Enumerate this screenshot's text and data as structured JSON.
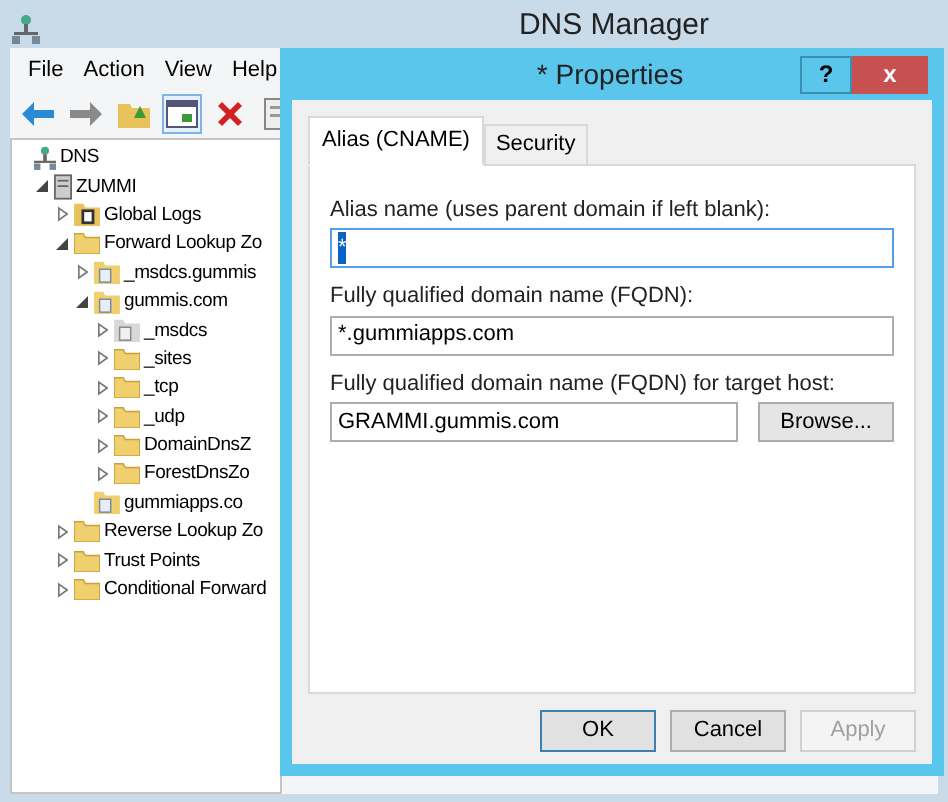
{
  "window": {
    "title": "DNS Manager"
  },
  "menu": [
    "File",
    "Action",
    "View",
    "Help"
  ],
  "toolbar": [
    {
      "kind": "back",
      "selected": false
    },
    {
      "kind": "forward",
      "selected": false
    },
    {
      "kind": "folder",
      "selected": false
    },
    {
      "kind": "panel",
      "selected": true
    },
    {
      "kind": "delete",
      "selected": false
    },
    {
      "kind": "page",
      "selected": false
    }
  ],
  "tree": [
    {
      "label": "DNS",
      "kind": "dns",
      "children": [
        {
          "label": "ZUMMI",
          "kind": "server",
          "expanded": true,
          "children": [
            {
              "label": "Global Logs",
              "kind": "log",
              "expanded": false
            },
            {
              "label": "Forward Lookup Zo",
              "kind": "folder",
              "expanded": true,
              "children": [
                {
                  "label": "_msdcs.gummis",
                  "kind": "zone",
                  "expanded": false
                },
                {
                  "label": "gummis.com",
                  "kind": "zone",
                  "expanded": true,
                  "children": [
                    {
                      "label": "_msdcs",
                      "kind": "zone-grey",
                      "expanded": false
                    },
                    {
                      "label": "_sites",
                      "kind": "folder",
                      "expanded": false
                    },
                    {
                      "label": "_tcp",
                      "kind": "folder",
                      "expanded": false
                    },
                    {
                      "label": "_udp",
                      "kind": "folder",
                      "expanded": false
                    },
                    {
                      "label": "DomainDnsZ",
                      "kind": "folder",
                      "expanded": false
                    },
                    {
                      "label": "ForestDnsZo",
                      "kind": "folder",
                      "expanded": false
                    }
                  ]
                },
                {
                  "label": "gummiapps.co",
                  "kind": "zone"
                }
              ]
            },
            {
              "label": "Reverse Lookup Zo",
              "kind": "folder",
              "expanded": false
            },
            {
              "label": "Trust Points",
              "kind": "folder",
              "expanded": false
            },
            {
              "label": "Conditional Forward",
              "kind": "folder",
              "expanded": false
            }
          ]
        }
      ]
    }
  ],
  "dialog": {
    "title": "* Properties",
    "help": "?",
    "close": "x",
    "tabs": [
      {
        "label": "Alias (CNAME)",
        "selected": true
      },
      {
        "label": "Security",
        "selected": false
      }
    ],
    "fields": [
      {
        "label": "Alias name (uses parent domain if left blank):",
        "value": "*",
        "selected": true
      },
      {
        "label": "Fully qualified domain name (FQDN):",
        "value": "*.gummiapps.com",
        "selected": false
      },
      {
        "label": "Fully qualified domain name (FQDN) for target host:",
        "value": "GRAMMI.gummis.com",
        "selected": false,
        "button": "Browse..."
      }
    ],
    "buttons": [
      {
        "label": "OK",
        "disabled": false,
        "default": true
      },
      {
        "label": "Cancel",
        "disabled": false,
        "default": false
      },
      {
        "label": "Apply",
        "disabled": true,
        "default": false
      }
    ]
  }
}
